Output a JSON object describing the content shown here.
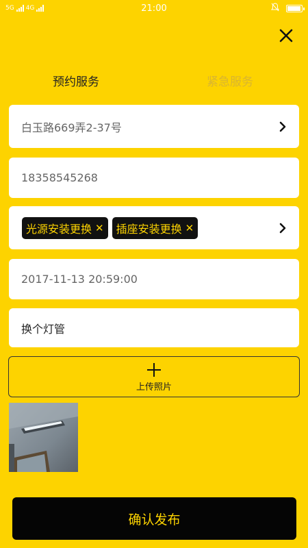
{
  "status_bar": {
    "left_text_1": "5G",
    "left_text_2": "4G",
    "time": "21:00"
  },
  "tabs": [
    {
      "label": "预约服务",
      "active": true
    },
    {
      "label": "紧急服务",
      "active": false
    }
  ],
  "form": {
    "address": "白玉路669弄2-37号",
    "phone": "18358545268",
    "tags": [
      {
        "label": "光源安装更换"
      },
      {
        "label": "插座安装更换"
      }
    ],
    "datetime": "2017-11-13 20:59:00",
    "description": "换个灯管"
  },
  "upload": {
    "label": "上传照片"
  },
  "submit_label": "确认发布",
  "colors": {
    "background": "#FDD300",
    "accent_text": "#FDD300",
    "button_bg": "#050505"
  }
}
